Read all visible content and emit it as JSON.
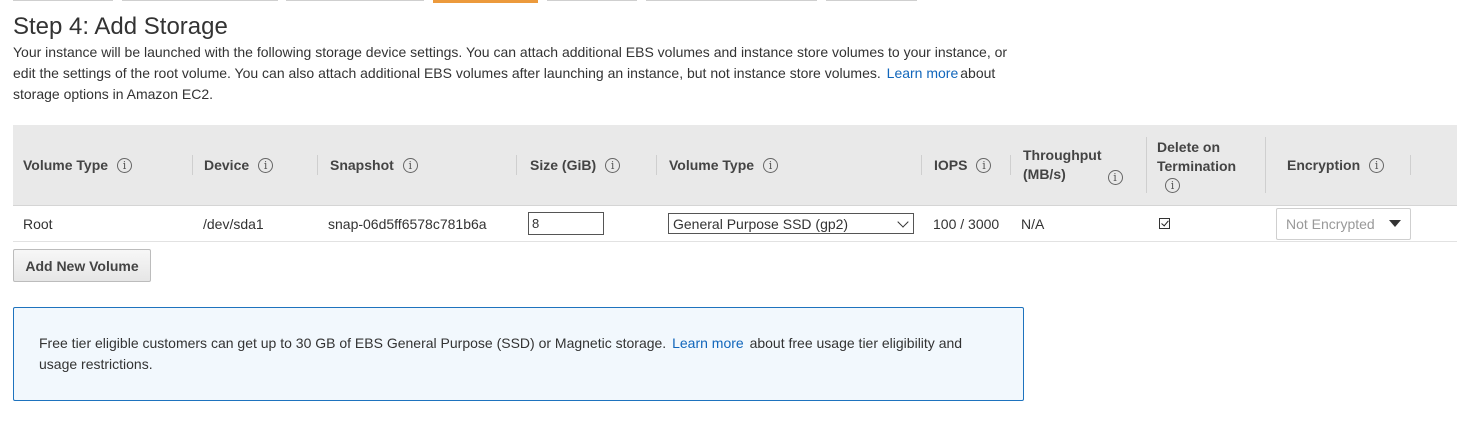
{
  "page": {
    "title": "Step 4: Add Storage",
    "desc_part1": "Your instance will be launched with the following storage device settings. You can attach additional EBS volumes and instance store volumes to your instance, or edit the settings of the root volume. You can also attach additional EBS volumes after launching an instance, but not instance store volumes.",
    "desc_link": "Learn more",
    "desc_part2": "about storage options in Amazon EC2."
  },
  "table": {
    "headers": {
      "volume_type": "Volume Type",
      "device": "Device",
      "snapshot": "Snapshot",
      "size": "Size (GiB)",
      "volume_type2": "Volume Type",
      "iops": "IOPS",
      "throughput_line1": "Throughput",
      "throughput_line2": "(MB/s)",
      "delete_line1": "Delete on",
      "delete_line2": "Termination",
      "encryption": "Encryption"
    },
    "info_glyph": "i",
    "row": {
      "volume_type": "Root",
      "device": "/dev/sda1",
      "snapshot": "snap-06d5ff6578c781b6a",
      "size": "8",
      "ebs_volume_type": "General Purpose SSD (gp2)",
      "iops": "100 / 3000",
      "throughput": "N/A",
      "delete_on_termination": true,
      "encryption": "Not Encrypted"
    }
  },
  "add_volume_label": "Add New Volume",
  "alert": {
    "text_part1": "Free tier eligible customers can get up to 30 GB of EBS General Purpose (SSD) or Magnetic storage.",
    "link": "Learn more",
    "text_part2": "about free usage tier eligibility and usage restrictions."
  },
  "colors": {
    "accent": "#ec9a3c",
    "link": "#1166bb",
    "alert_border": "#1e73be",
    "header_bg": "#e9e9e9"
  }
}
